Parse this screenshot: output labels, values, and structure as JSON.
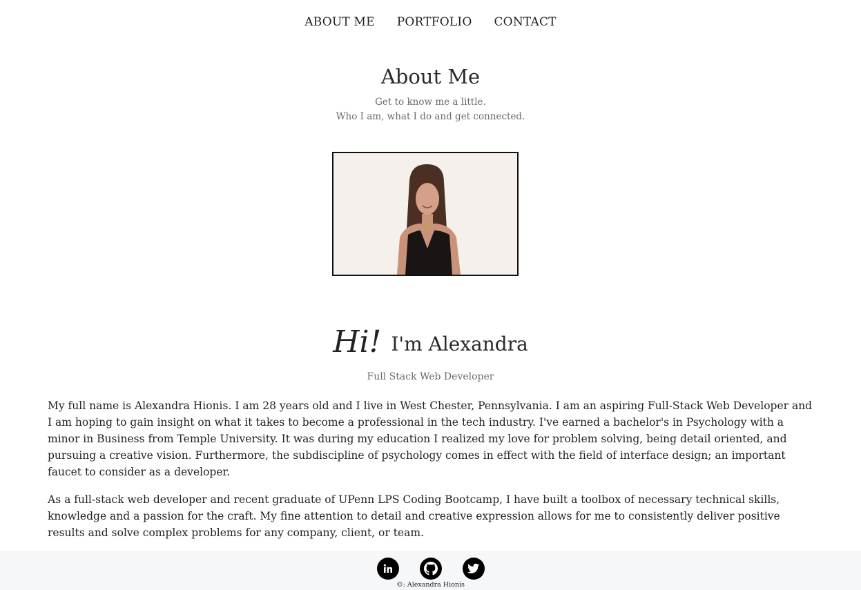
{
  "nav": {
    "items": [
      {
        "label": "ABOUT ME"
      },
      {
        "label": "PORTFOLIO"
      },
      {
        "label": "CONTACT"
      }
    ]
  },
  "header": {
    "title": "About Me",
    "subtitle_line1": "Get to know me a little.",
    "subtitle_line2": "Who I am, what I do and get connected."
  },
  "profile": {
    "hi_text": "Hi!",
    "name_text": "I'm Alexandra",
    "role": "Full Stack Web Developer"
  },
  "bio": {
    "paragraph1": "My full name is Alexandra Hionis. I am 28 years old and I live in West Chester, Pennsylvania. I am an aspiring Full-Stack Web Developer and I am hoping to gain insight on what it takes to become a professional in the tech industry. I've earned a bachelor's in Psychology with a minor in Business from Temple University. It was during my education I realized my love for problem solving, being detail oriented, and pursuing a creative vision. Furthermore, the subdiscipline of psychology comes in effect with the field of interface design; an important faucet to consider as a developer.",
    "paragraph2": "As a full-stack web developer and recent graduate of UPenn LPS Coding Bootcamp, I have built a toolbox of necessary technical skills, knowledge and a passion for the craft. My fine attention to detail and creative expression allows for me to consistently deliver positive results and solve complex problems for any company, client, or team."
  },
  "footer": {
    "social_icons": [
      "linkedin-icon",
      "github-icon",
      "twitter-icon"
    ],
    "copyright": "©: Alexandra Hionis"
  },
  "colors": {
    "text": "#222222",
    "muted": "#6b6b6b",
    "footer_bg": "#f6f7f9",
    "photo_bg": "#f5f0ec"
  }
}
